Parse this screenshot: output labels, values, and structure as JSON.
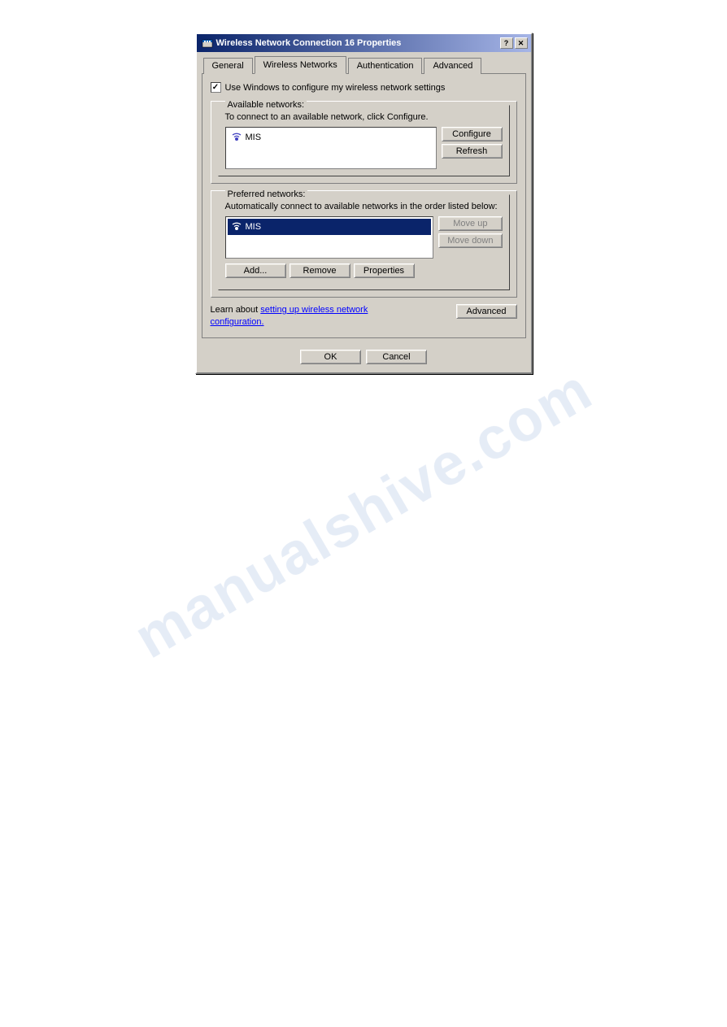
{
  "window": {
    "title": "Wireless Network Connection 16 Properties",
    "help_btn": "?",
    "close_btn": "✕"
  },
  "tabs": [
    {
      "id": "general",
      "label": "General",
      "active": false
    },
    {
      "id": "wireless_networks",
      "label": "Wireless Networks",
      "active": true
    },
    {
      "id": "authentication",
      "label": "Authentication",
      "active": false
    },
    {
      "id": "advanced",
      "label": "Advanced",
      "active": false
    }
  ],
  "wireless_tab": {
    "checkbox_label": "Use Windows to configure my wireless network settings",
    "checkbox_checked": true,
    "available_networks": {
      "group_label": "Available networks:",
      "description": "To connect to an available network, click Configure.",
      "networks": [
        {
          "name": "MIS",
          "selected": false
        }
      ],
      "configure_btn": "Configure",
      "refresh_btn": "Refresh"
    },
    "preferred_networks": {
      "group_label": "Preferred networks:",
      "description": "Automatically connect to available networks in the order listed below:",
      "networks": [
        {
          "name": "MIS",
          "selected": true
        }
      ],
      "move_up_btn": "Move up",
      "move_down_btn": "Move down",
      "add_btn": "Add...",
      "remove_btn": "Remove",
      "properties_btn": "Properties"
    },
    "learn_text": "Learn about",
    "learn_link": "setting up wireless network configuration.",
    "advanced_btn": "Advanced"
  },
  "footer": {
    "ok_btn": "OK",
    "cancel_btn": "Cancel"
  }
}
